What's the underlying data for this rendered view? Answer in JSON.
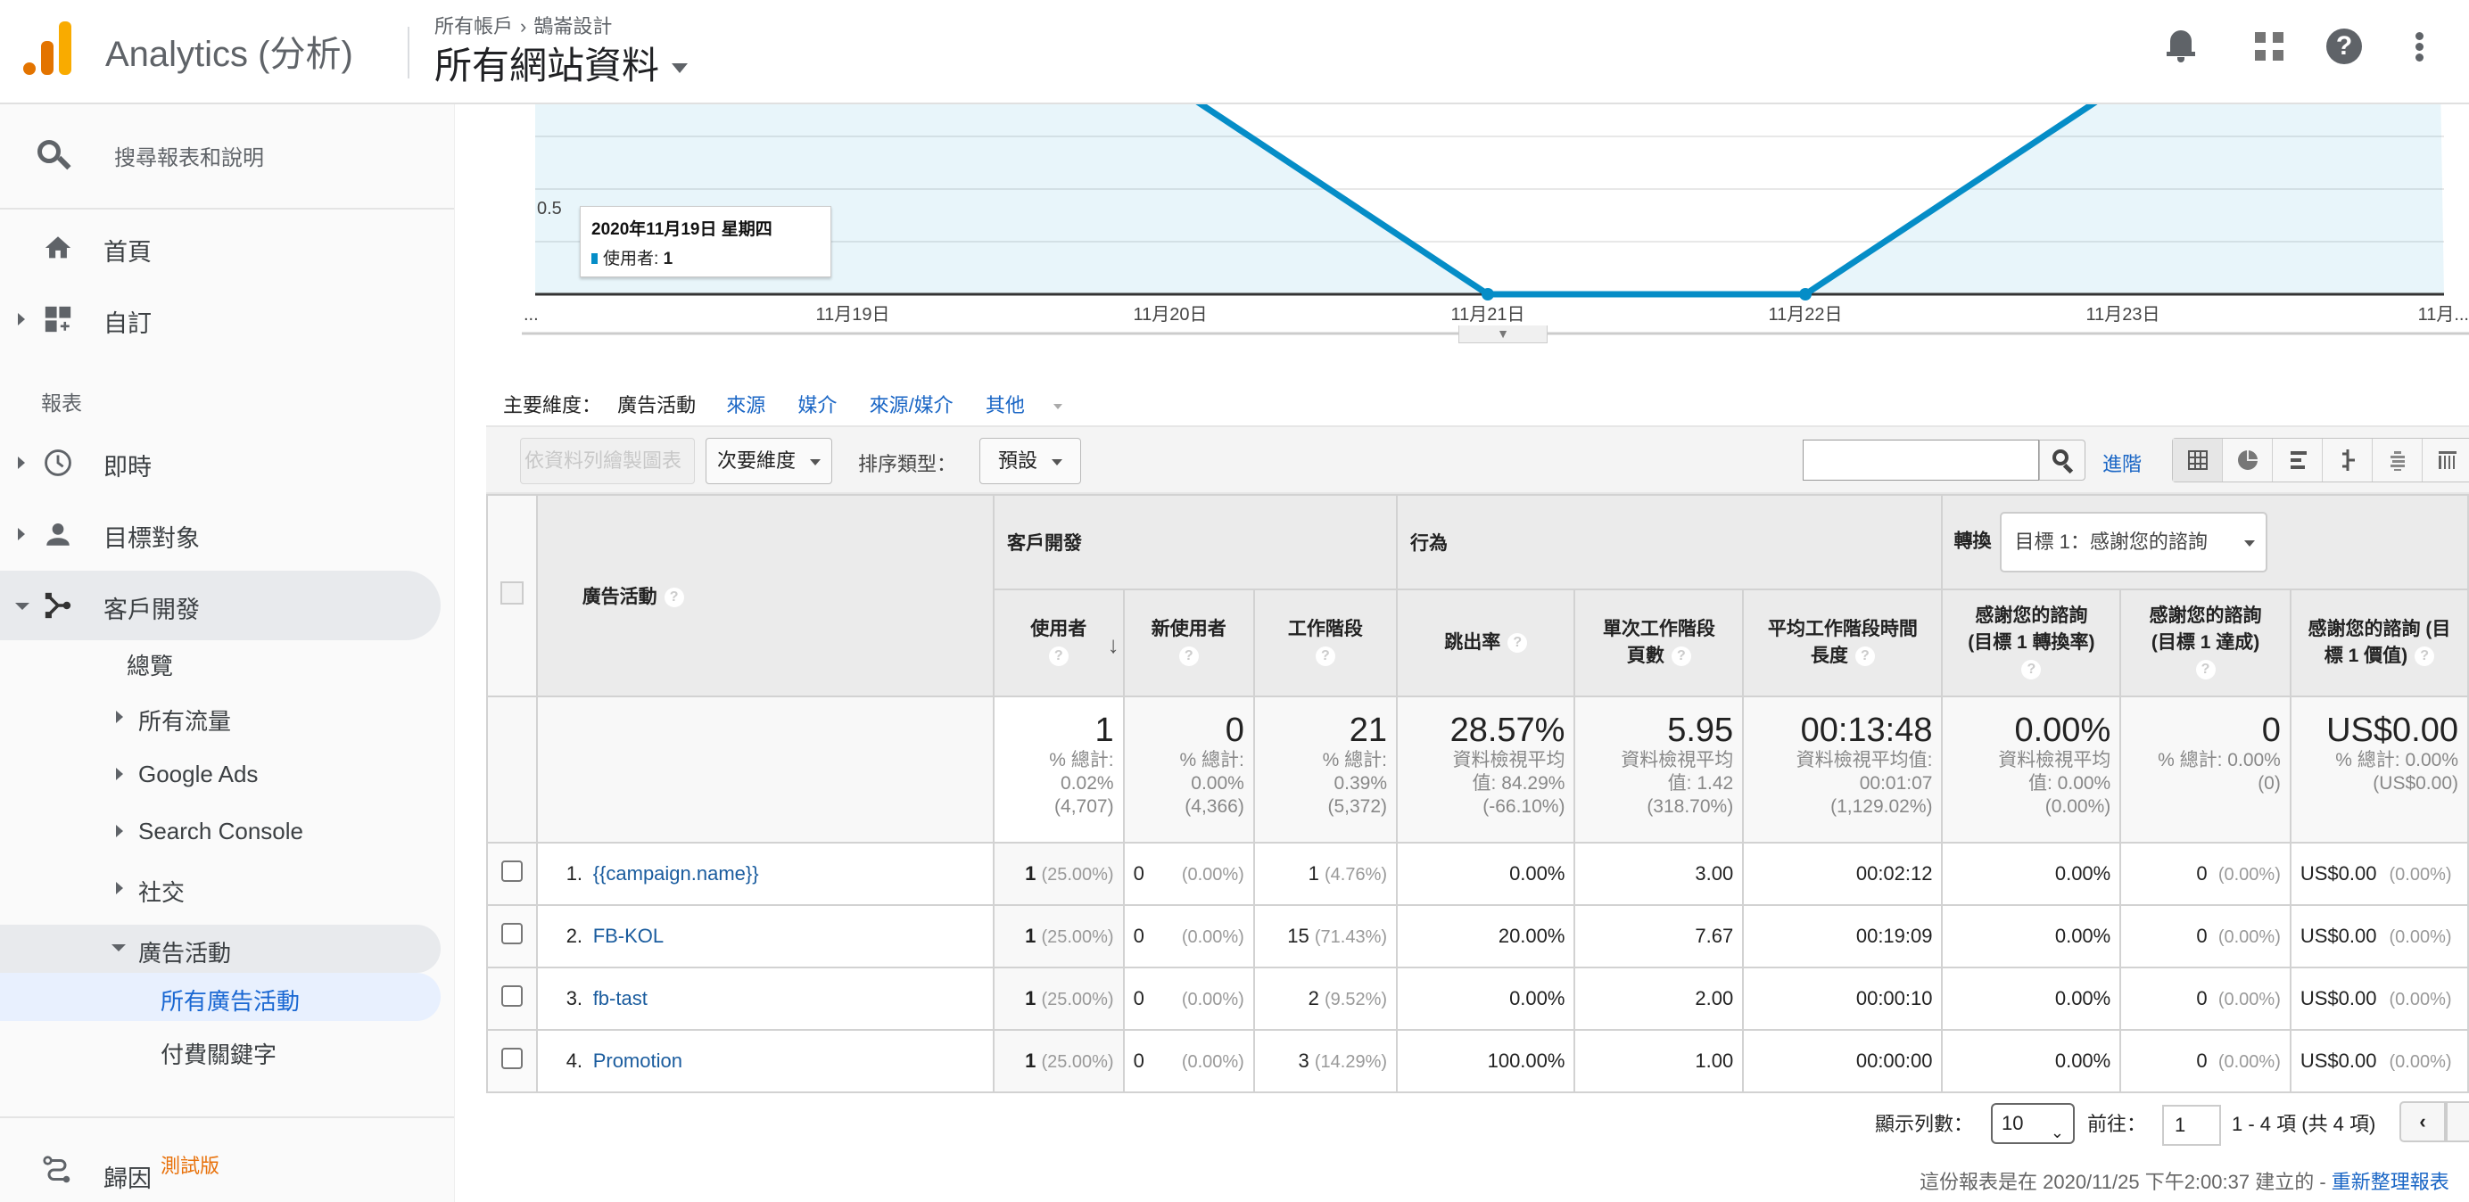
{
  "header": {
    "app_title": "Analytics (分析)",
    "breadcrumb": [
      "所有帳戶",
      "鵠崙設計"
    ],
    "view_name": "所有網站資料",
    "icons": [
      "bell-icon",
      "apps-grid-icon",
      "help-icon",
      "more-vert-icon"
    ]
  },
  "sidebar": {
    "search_label": "搜尋報表和說明",
    "home": "首頁",
    "customization": "自訂",
    "section_reports": "報表",
    "realtime": "即時",
    "audience": "目標對象",
    "acquisition": "客戶開發",
    "acq_items": {
      "overview": "總覽",
      "all_traffic": "所有流量",
      "google_ads": "Google Ads",
      "search_console": "Search Console",
      "social": "社交",
      "campaigns": "廣告活動"
    },
    "campaign_items": {
      "all_campaigns": "所有廣告活動",
      "paid_keywords": "付費關鍵字"
    },
    "attribution": "歸因",
    "attribution_badge": "測試版"
  },
  "chart_data": {
    "type": "area",
    "series": [
      {
        "name": "使用者",
        "color": "#058dc7",
        "values": [
          null,
          1,
          0,
          0,
          1,
          null
        ]
      }
    ],
    "x": [
      "...",
      "11月19日",
      "11月20日",
      "11月21日",
      "11月22日",
      "11月23日",
      "11月..."
    ],
    "visible_points": [
      {
        "x": "11月20日",
        "y": 1
      },
      {
        "x": "11月21日",
        "y": 0
      },
      {
        "x": "11月22日",
        "y": 0
      },
      {
        "x": "11月23日",
        "y": 1
      }
    ],
    "y_tick_labels": [
      "0.5"
    ],
    "ylim_visible": [
      0,
      0.8
    ],
    "grid": true,
    "tooltip": {
      "date": "2020年11月19日 星期四",
      "metric": "使用者",
      "value": "1"
    }
  },
  "dimensions": {
    "label": "主要維度：",
    "current": "廣告活動",
    "links": [
      "來源",
      "媒介",
      "來源/媒介",
      "其他"
    ]
  },
  "toolbar": {
    "plot_rows": "依資料列繪製圖表",
    "secondary_dim": "次要維度",
    "sort_label": "排序類型：",
    "sort_value": "預設",
    "search_value": "",
    "advanced": "進階"
  },
  "table": {
    "dim_header": "廣告活動",
    "groups": {
      "acquisition": "客戶開發",
      "behavior": "行為",
      "conversion": "轉換"
    },
    "goal_select": "目標 1：感謝您的諮詢",
    "columns": [
      "使用者",
      "新使用者",
      "工作階段",
      "跳出率",
      "單次工作階段頁數",
      "平均工作階段時間長度",
      "感謝您的諮詢 (目標 1 轉換率)",
      "感謝您的諮詢 (目標 1 達成)",
      "感謝您的諮詢 (目標 1 價值)"
    ],
    "col_lines": [
      [
        "使用者"
      ],
      [
        "新使用者"
      ],
      [
        "工作階段"
      ],
      [
        "跳出率"
      ],
      [
        "單次工作階段",
        "頁數"
      ],
      [
        "平均工作階段時間",
        "長度"
      ],
      [
        "感謝您的諮詢",
        "(目標 1 轉換率)"
      ],
      [
        "感謝您的諮詢",
        "(目標 1 達成)"
      ],
      [
        "感謝您的諮詢 (目",
        "標 1 價值)"
      ]
    ],
    "totals": [
      {
        "value": "1",
        "sub": [
          "% 總計:",
          "0.02%",
          "(4,707)"
        ]
      },
      {
        "value": "0",
        "sub": [
          "% 總計:",
          "0.00%",
          "(4,366)"
        ]
      },
      {
        "value": "21",
        "sub": [
          "% 總計:",
          "0.39%",
          "(5,372)"
        ]
      },
      {
        "value": "28.57%",
        "sub": [
          "資料檢視平均",
          "值: 84.29%",
          "(-66.10%)"
        ]
      },
      {
        "value": "5.95",
        "sub": [
          "資料檢視平均",
          "值: 1.42",
          "(318.70%)"
        ]
      },
      {
        "value": "00:13:48",
        "sub": [
          "資料檢視平均值:",
          "00:01:07",
          "(1,129.02%)"
        ]
      },
      {
        "value": "0.00%",
        "sub": [
          "資料檢視平均",
          "值: 0.00%",
          "(0.00%)"
        ]
      },
      {
        "value": "0",
        "sub": [
          "% 總計: 0.00%",
          "(0)"
        ]
      },
      {
        "value": "US$0.00",
        "sub": [
          "% 總計: 0.00%",
          "(US$0.00)"
        ]
      }
    ],
    "rows": [
      {
        "index": "1.",
        "campaign": "{{campaign.name}}",
        "users": "1",
        "users_pct": "(25.00%)",
        "new_users": "0",
        "new_users_pct": "(0.00%)",
        "sessions": "1",
        "sessions_pct": "(4.76%)",
        "bounce": "0.00%",
        "pages": "3.00",
        "duration": "00:02:12",
        "conv_rate": "0.00%",
        "completions": "0",
        "completions_pct": "(0.00%)",
        "value": "US$0.00",
        "value_pct": "(0.00%)"
      },
      {
        "index": "2.",
        "campaign": "FB-KOL",
        "users": "1",
        "users_pct": "(25.00%)",
        "new_users": "0",
        "new_users_pct": "(0.00%)",
        "sessions": "15",
        "sessions_pct": "(71.43%)",
        "bounce": "20.00%",
        "pages": "7.67",
        "duration": "00:19:09",
        "conv_rate": "0.00%",
        "completions": "0",
        "completions_pct": "(0.00%)",
        "value": "US$0.00",
        "value_pct": "(0.00%)"
      },
      {
        "index": "3.",
        "campaign": "fb-tast",
        "users": "1",
        "users_pct": "(25.00%)",
        "new_users": "0",
        "new_users_pct": "(0.00%)",
        "sessions": "2",
        "sessions_pct": "(9.52%)",
        "bounce": "0.00%",
        "pages": "2.00",
        "duration": "00:00:10",
        "conv_rate": "0.00%",
        "completions": "0",
        "completions_pct": "(0.00%)",
        "value": "US$0.00",
        "value_pct": "(0.00%)"
      },
      {
        "index": "4.",
        "campaign": "Promotion",
        "users": "1",
        "users_pct": "(25.00%)",
        "new_users": "0",
        "new_users_pct": "(0.00%)",
        "sessions": "3",
        "sessions_pct": "(14.29%)",
        "bounce": "100.00%",
        "pages": "1.00",
        "duration": "00:00:00",
        "conv_rate": "0.00%",
        "completions": "0",
        "completions_pct": "(0.00%)",
        "value": "US$0.00",
        "value_pct": "(0.00%)"
      }
    ]
  },
  "pager": {
    "rows_label": "顯示列數：",
    "rows_value": "10",
    "goto_label": "前往：",
    "goto_value": "1",
    "range": "1 - 4 項 (共 4 項)"
  },
  "footer": {
    "created": "這份報表是在 2020/11/25 下午2:00:37 建立的 - ",
    "refresh_link": "重新整理報表"
  },
  "colors": {
    "accent": "#058dc7",
    "link": "#1a66c5",
    "beta": "#e8710a",
    "logo_dark": "#e37400",
    "logo_light": "#f9ab00"
  }
}
